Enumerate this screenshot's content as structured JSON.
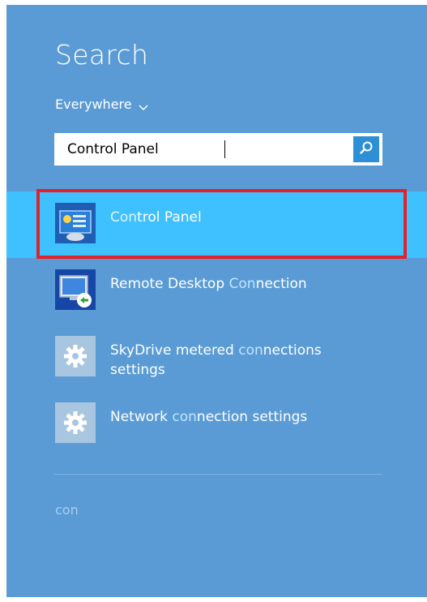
{
  "header": {
    "title": "Search",
    "scope_label": "Everywhere"
  },
  "search": {
    "value": "Control Panel",
    "button_icon": "search-icon"
  },
  "results": [
    {
      "id": "control-panel",
      "parts": [
        {
          "text": "Con",
          "hl": true
        },
        {
          "text": "trol Panel",
          "hl": false
        }
      ],
      "icon": "control-panel-icon",
      "selected": true
    },
    {
      "id": "remote-desktop",
      "parts": [
        {
          "text": "Remote Desktop ",
          "hl": false
        },
        {
          "text": "Con",
          "hl": true
        },
        {
          "text": "nection",
          "hl": false
        }
      ],
      "icon": "remote-desktop-icon",
      "selected": false
    },
    {
      "id": "skydrive-metered",
      "parts": [
        {
          "text": "SkyDrive metered ",
          "hl": false
        },
        {
          "text": "con",
          "hl": true
        },
        {
          "text": "nections settings",
          "hl": false
        }
      ],
      "icon": "gear-icon",
      "selected": false
    },
    {
      "id": "network-connection",
      "parts": [
        {
          "text": "Network ",
          "hl": false
        },
        {
          "text": "con",
          "hl": true
        },
        {
          "text": "nection settings",
          "hl": false
        }
      ],
      "icon": "gear-icon",
      "selected": false
    }
  ],
  "footer": {
    "query_text": "con"
  },
  "colors": {
    "pane_background": "#5b9bd5",
    "selected_background": "#3fc0ff",
    "highlight_border": "#e3212b",
    "search_button": "#2d8fd6"
  }
}
